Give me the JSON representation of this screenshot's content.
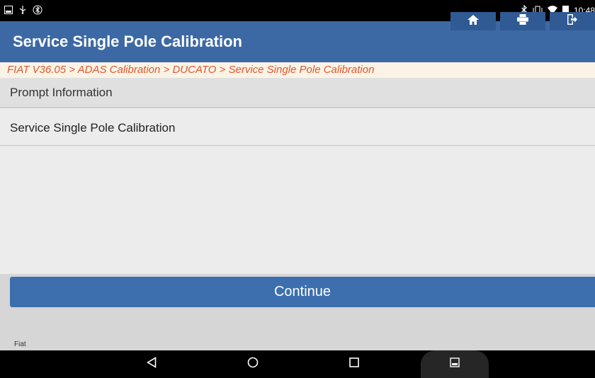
{
  "status_bar": {
    "time": "10:48",
    "left_icons": [
      "image-icon",
      "usb-icon",
      "bluetooth-settings-icon"
    ],
    "right_icons": [
      "bluetooth-icon",
      "vibrate-icon",
      "wifi-icon",
      "battery-icon"
    ]
  },
  "header": {
    "title": "Service Single Pole Calibration",
    "buttons": [
      "home-icon",
      "print-icon",
      "exit-icon"
    ]
  },
  "breadcrumb": "FIAT V36.05 > ADAS Calibration > DUCATO > Service Single Pole Calibration",
  "prompt": {
    "header": "Prompt Information",
    "message": "Service Single Pole Calibration"
  },
  "actions": {
    "continue_label": "Continue"
  },
  "footer": {
    "label": "Fiat"
  },
  "colors": {
    "titlebar": "#3c69a4",
    "button": "#3d6fae",
    "breadcrumb_text": "#e0552f"
  }
}
